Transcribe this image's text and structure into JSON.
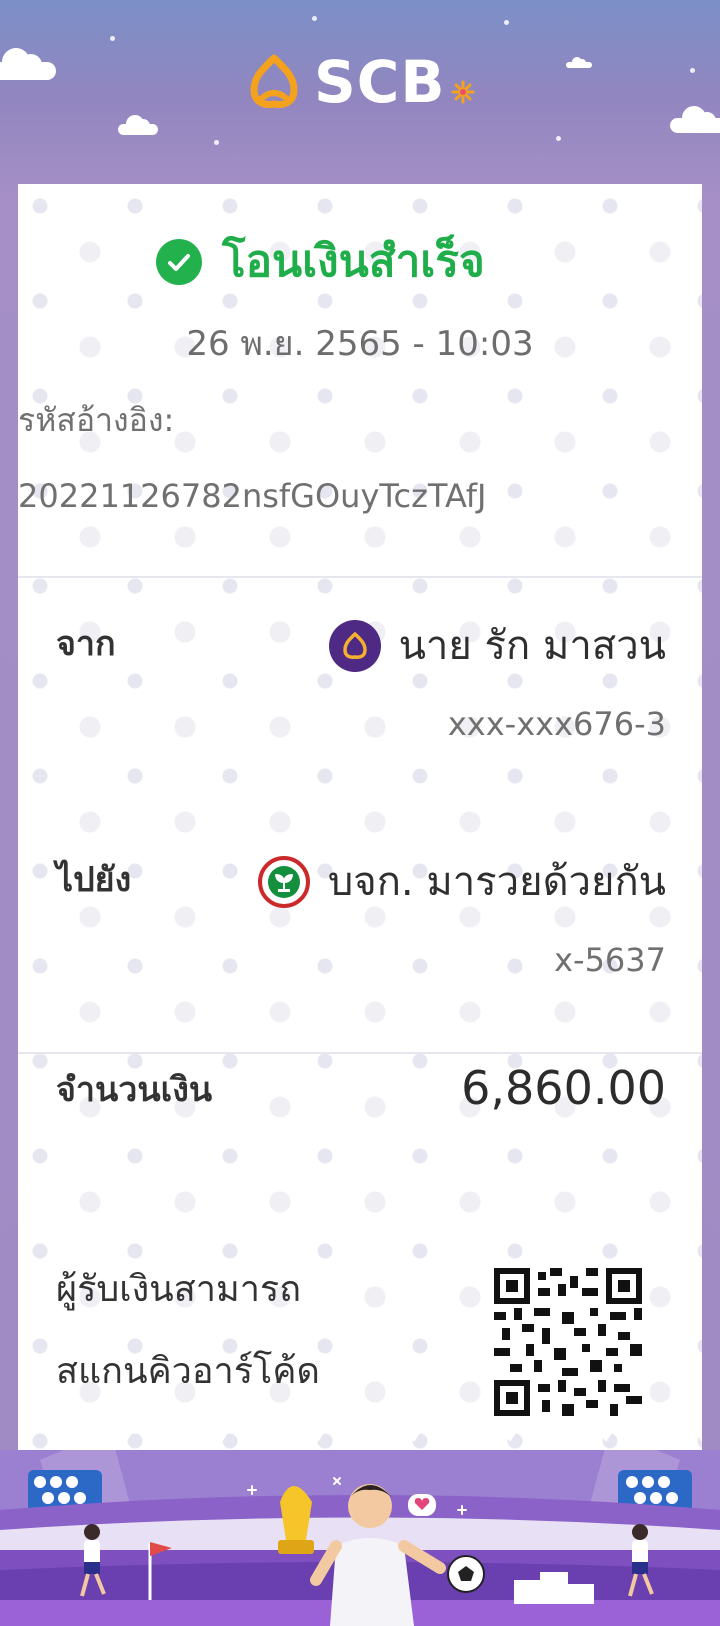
{
  "header": {
    "brand_name": "SCB",
    "brand_color": "#f4a21e"
  },
  "receipt": {
    "status_text": "โอนเงินสำเร็จ",
    "status_color": "#1fae4a",
    "datetime": "26 พ.ย. 2565 - 10:03",
    "reference_label": "รหัสอ้างอิง:",
    "reference_value": "20221126782nsfGOuyTczTAfJ",
    "from": {
      "label": "จาก",
      "bank_icon": "scb-bank-icon",
      "name": "นาย รัก มาสวน",
      "account": "xxx-xxx676-3"
    },
    "to": {
      "label": "ไปยัง",
      "bank_icon": "kbank-bank-icon",
      "name": "บจก. มารวยด้วยกัน",
      "account": "x-5637"
    },
    "amount": {
      "label": "จำนวนเงิน",
      "value": "6,860.00"
    },
    "qr_note": {
      "line1": "ผู้รับเงินสามารถ",
      "line2": "สแกนคิวอาร์โค้ด"
    }
  },
  "footer": {
    "illustration": "football-world-cup-banner"
  }
}
